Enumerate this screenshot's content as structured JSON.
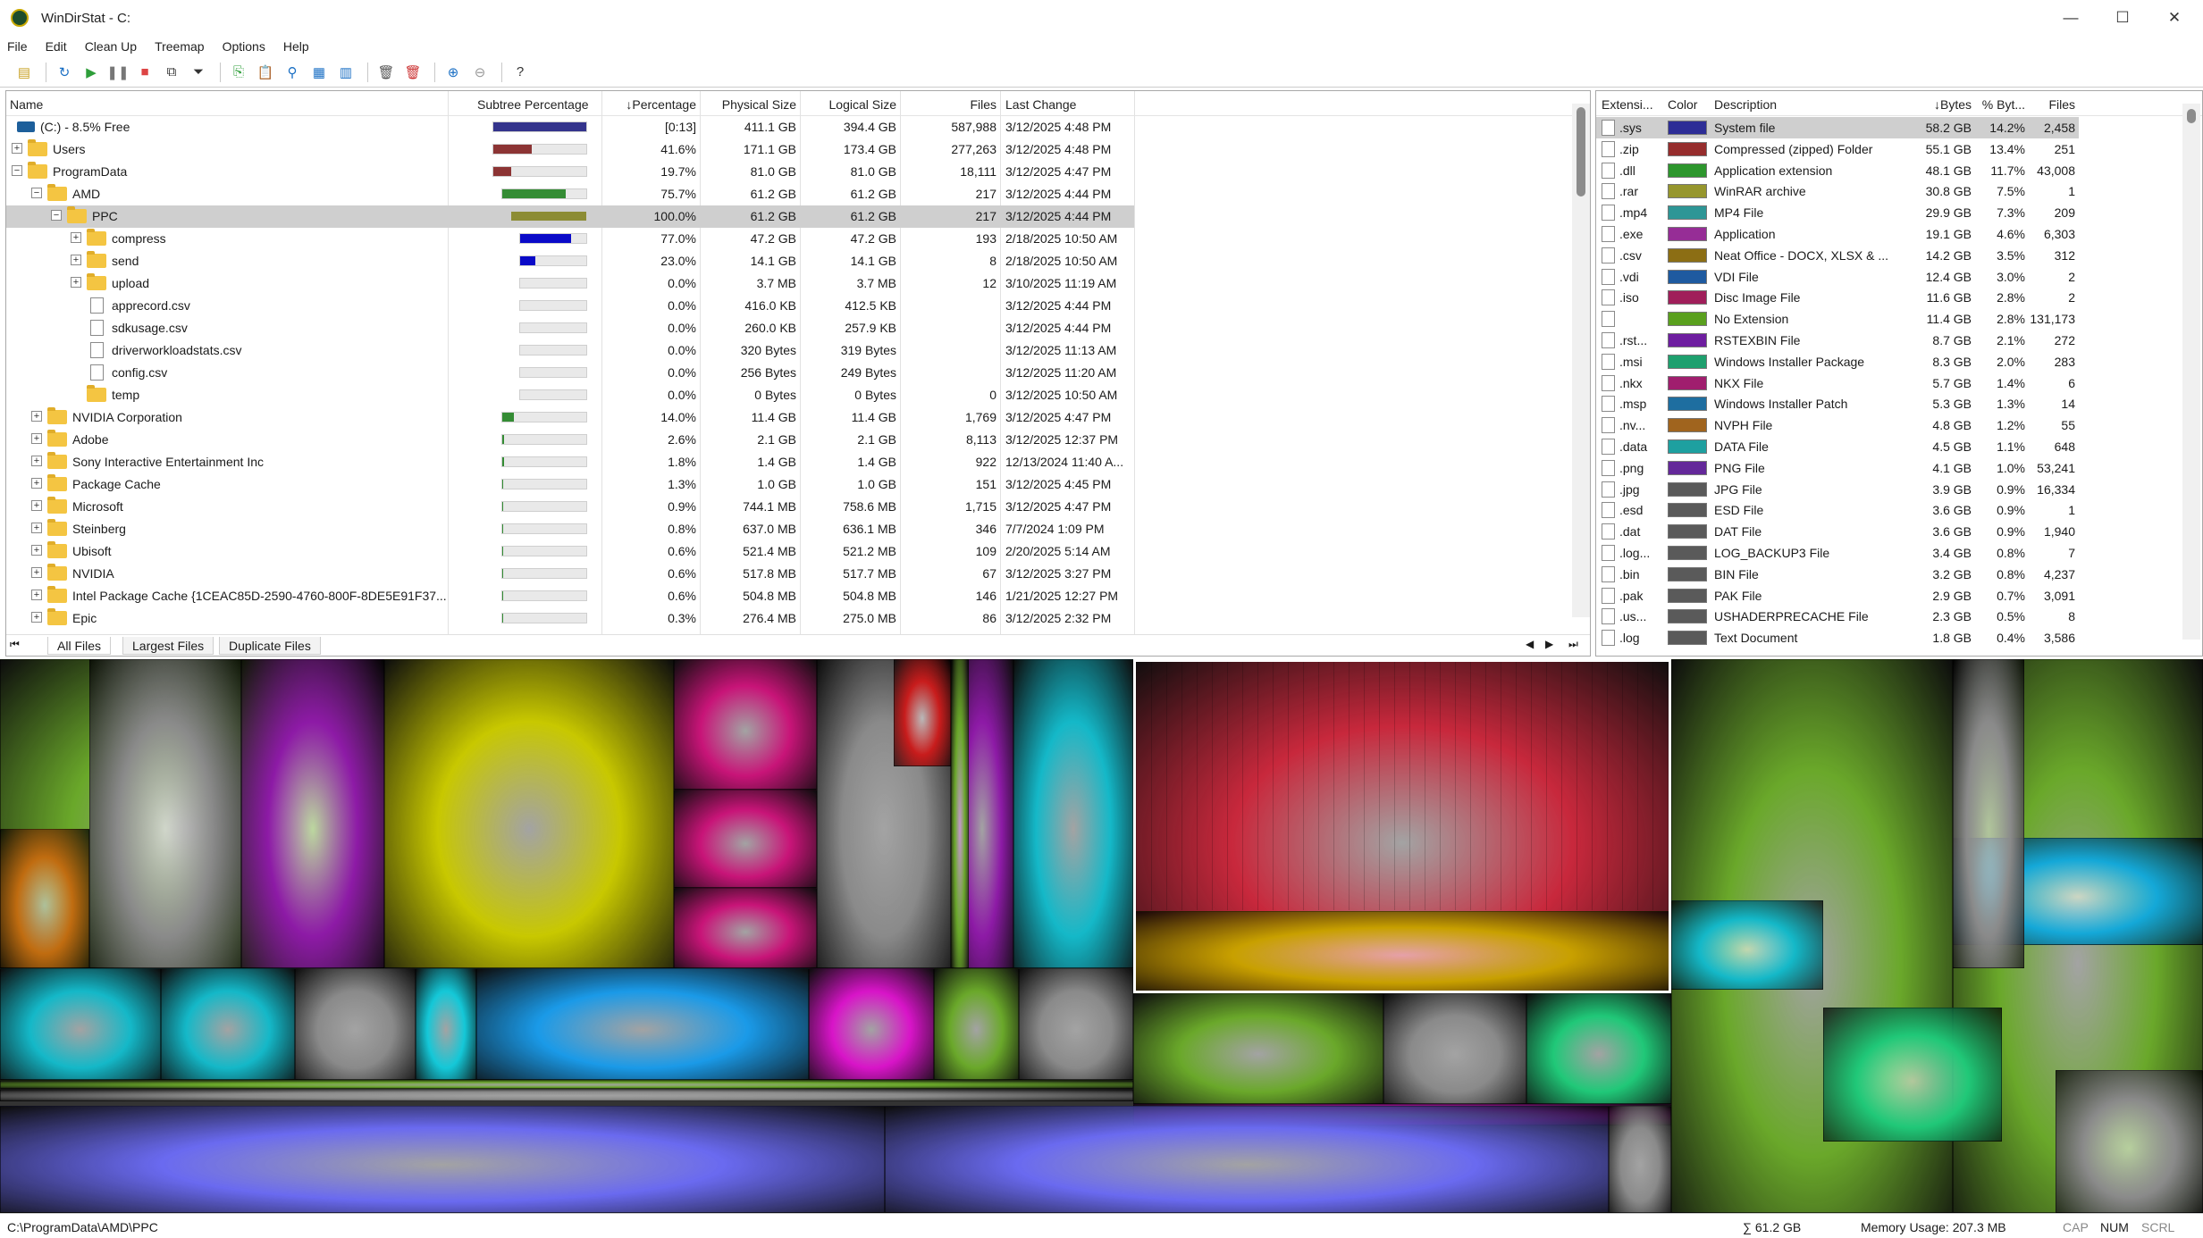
{
  "window": {
    "title": "WinDirStat - C:"
  },
  "menu": [
    "File",
    "Edit",
    "Clean Up",
    "Treemap",
    "Options",
    "Help"
  ],
  "toolbar_icons": [
    "open-icon",
    "refresh-icon",
    "play-icon",
    "pause-icon",
    "stop-icon",
    "copy-path-icon",
    "filter-icon",
    "new-doc-icon",
    "paste-icon",
    "explorer-icon",
    "properties-icon",
    "report-icon",
    "delete-icon",
    "delete-permanent-icon",
    "zoom-in-icon",
    "zoom-out-icon",
    "help-icon"
  ],
  "tree": {
    "headers": {
      "name": "Name",
      "subtree": "Subtree Percentage",
      "percentage": "↓Percentage",
      "physical": "Physical Size",
      "logical": "Logical Size",
      "files": "Files",
      "last_change": "Last Change"
    },
    "rows": [
      {
        "name": "(C:) - 8.5% Free",
        "level": 0,
        "type": "drive",
        "bar": 1.0,
        "barcolor": "#34348c",
        "pct": "[0:13]",
        "phys": "411.1 GB",
        "log": "394.4 GB",
        "files": "587,988",
        "date": "3/12/2025  4:48 PM"
      },
      {
        "name": "Users",
        "level": 0,
        "type": "folder",
        "tog": "+",
        "bar": 0.416,
        "barcolor": "#8c3434",
        "pct": "41.6%",
        "phys": "171.1 GB",
        "log": "173.4 GB",
        "files": "277,263",
        "date": "3/12/2025  4:48 PM"
      },
      {
        "name": "ProgramData",
        "level": 0,
        "type": "folder",
        "tog": "−",
        "bar": 0.197,
        "barcolor": "#8c3434",
        "pct": "19.7%",
        "phys": "81.0 GB",
        "log": "81.0 GB",
        "files": "18,111",
        "date": "3/12/2025  4:47 PM"
      },
      {
        "name": "AMD",
        "level": 1,
        "type": "folder",
        "tog": "−",
        "bar": 0.757,
        "barcolor": "#348c34",
        "pct": "75.7%",
        "phys": "61.2 GB",
        "log": "61.2 GB",
        "files": "217",
        "date": "3/12/2025  4:44 PM"
      },
      {
        "name": "PPC",
        "level": 2,
        "type": "folder",
        "tog": "−",
        "bar": 1.0,
        "barcolor": "#8c8c34",
        "pct": "100.0%",
        "phys": "61.2 GB",
        "log": "61.2 GB",
        "files": "217",
        "date": "3/12/2025  4:44 PM",
        "selected": true
      },
      {
        "name": "compress",
        "level": 3,
        "type": "folder",
        "tog": "+",
        "bar": 0.77,
        "barcolor": "#0a0ac8",
        "pct": "77.0%",
        "phys": "47.2 GB",
        "log": "47.2 GB",
        "files": "193",
        "date": "2/18/2025  10:50 AM"
      },
      {
        "name": "send",
        "level": 3,
        "type": "folder",
        "tog": "+",
        "bar": 0.23,
        "barcolor": "#0a0ac8",
        "pct": "23.0%",
        "phys": "14.1 GB",
        "log": "14.1 GB",
        "files": "8",
        "date": "2/18/2025  10:50 AM"
      },
      {
        "name": "upload",
        "level": 3,
        "type": "folder",
        "tog": "+",
        "bar": 0.0,
        "barcolor": "#0a0ac8",
        "pct": "0.0%",
        "phys": "3.7 MB",
        "log": "3.7 MB",
        "files": "12",
        "date": "3/10/2025  11:19 AM"
      },
      {
        "name": "apprecord.csv",
        "level": 3,
        "type": "file",
        "bar": 0.0,
        "barcolor": "#0a0ac8",
        "pct": "0.0%",
        "phys": "416.0 KB",
        "log": "412.5 KB",
        "files": "",
        "date": "3/12/2025  4:44 PM"
      },
      {
        "name": "sdkusage.csv",
        "level": 3,
        "type": "file",
        "bar": 0.0,
        "barcolor": "#0a0ac8",
        "pct": "0.0%",
        "phys": "260.0 KB",
        "log": "257.9 KB",
        "files": "",
        "date": "3/12/2025  4:44 PM"
      },
      {
        "name": "driverworkloadstats.csv",
        "level": 3,
        "type": "file",
        "bar": 0.0,
        "barcolor": "#0a0ac8",
        "pct": "0.0%",
        "phys": "320 Bytes",
        "log": "319 Bytes",
        "files": "",
        "date": "3/12/2025  11:13 AM"
      },
      {
        "name": "config.csv",
        "level": 3,
        "type": "file",
        "bar": 0.0,
        "barcolor": "#0a0ac8",
        "pct": "0.0%",
        "phys": "256 Bytes",
        "log": "249 Bytes",
        "files": "",
        "date": "3/12/2025  11:20 AM"
      },
      {
        "name": "temp",
        "level": 3,
        "type": "folder",
        "bar": 0.0,
        "barcolor": "#0a0ac8",
        "pct": "0.0%",
        "phys": "0 Bytes",
        "log": "0 Bytes",
        "files": "0",
        "date": "3/12/2025  10:50 AM"
      },
      {
        "name": "NVIDIA Corporation",
        "level": 1,
        "type": "folder",
        "tog": "+",
        "bar": 0.14,
        "barcolor": "#348c34",
        "pct": "14.0%",
        "phys": "11.4 GB",
        "log": "11.4 GB",
        "files": "1,769",
        "date": "3/12/2025  4:47 PM"
      },
      {
        "name": "Adobe",
        "level": 1,
        "type": "folder",
        "tog": "+",
        "bar": 0.026,
        "barcolor": "#348c34",
        "pct": "2.6%",
        "phys": "2.1 GB",
        "log": "2.1 GB",
        "files": "8,113",
        "date": "3/12/2025  12:37 PM"
      },
      {
        "name": "Sony Interactive Entertainment Inc",
        "level": 1,
        "type": "folder",
        "tog": "+",
        "bar": 0.018,
        "barcolor": "#348c34",
        "pct": "1.8%",
        "phys": "1.4 GB",
        "log": "1.4 GB",
        "files": "922",
        "date": "12/13/2024  11:40 A..."
      },
      {
        "name": "Package Cache",
        "level": 1,
        "type": "folder",
        "tog": "+",
        "bar": 0.013,
        "barcolor": "#348c34",
        "pct": "1.3%",
        "phys": "1.0 GB",
        "log": "1.0 GB",
        "files": "151",
        "date": "3/12/2025  4:45 PM"
      },
      {
        "name": "Microsoft",
        "level": 1,
        "type": "folder",
        "tog": "+",
        "bar": 0.009,
        "barcolor": "#348c34",
        "pct": "0.9%",
        "phys": "744.1 MB",
        "log": "758.6 MB",
        "files": "1,715",
        "date": "3/12/2025  4:47 PM"
      },
      {
        "name": "Steinberg",
        "level": 1,
        "type": "folder",
        "tog": "+",
        "bar": 0.008,
        "barcolor": "#348c34",
        "pct": "0.8%",
        "phys": "637.0 MB",
        "log": "636.1 MB",
        "files": "346",
        "date": "7/7/2024  1:09 PM"
      },
      {
        "name": "Ubisoft",
        "level": 1,
        "type": "folder",
        "tog": "+",
        "bar": 0.006,
        "barcolor": "#348c34",
        "pct": "0.6%",
        "phys": "521.4 MB",
        "log": "521.2 MB",
        "files": "109",
        "date": "2/20/2025  5:14 AM"
      },
      {
        "name": "NVIDIA",
        "level": 1,
        "type": "folder",
        "tog": "+",
        "bar": 0.006,
        "barcolor": "#348c34",
        "pct": "0.6%",
        "phys": "517.8 MB",
        "log": "517.7 MB",
        "files": "67",
        "date": "3/12/2025  3:27 PM"
      },
      {
        "name": "Intel Package Cache {1CEAC85D-2590-4760-800F-8DE5E91F37...",
        "level": 1,
        "type": "folder",
        "tog": "+",
        "bar": 0.006,
        "barcolor": "#348c34",
        "pct": "0.6%",
        "phys": "504.8 MB",
        "log": "504.8 MB",
        "files": "146",
        "date": "1/21/2025  12:27 PM"
      },
      {
        "name": "Epic",
        "level": 1,
        "type": "folder",
        "tog": "+",
        "bar": 0.003,
        "barcolor": "#348c34",
        "pct": "0.3%",
        "phys": "276.4 MB",
        "log": "275.0 MB",
        "files": "86",
        "date": "3/12/2025  2:32 PM"
      }
    ],
    "tabs": [
      "All Files",
      "Largest Files",
      "Duplicate Files"
    ]
  },
  "ext": {
    "headers": {
      "ext": "Extensi...",
      "color": "Color",
      "desc": "Description",
      "bytes": "↓Bytes",
      "pct": "% Byt...",
      "files": "Files"
    },
    "rows": [
      {
        "ext": ".sys",
        "color": "#2d2d96",
        "desc": "System file",
        "bytes": "58.2 GB",
        "pct": "14.2%",
        "files": "2,458",
        "selected": true
      },
      {
        "ext": ".zip",
        "color": "#962d2d",
        "desc": "Compressed (zipped) Folder",
        "bytes": "55.1 GB",
        "pct": "13.4%",
        "files": "251"
      },
      {
        "ext": ".dll",
        "color": "#2d962d",
        "desc": "Application extension",
        "bytes": "48.1 GB",
        "pct": "11.7%",
        "files": "43,008"
      },
      {
        "ext": ".rar",
        "color": "#96962d",
        "desc": "WinRAR archive",
        "bytes": "30.8 GB",
        "pct": "7.5%",
        "files": "1"
      },
      {
        "ext": ".mp4",
        "color": "#2d9696",
        "desc": "MP4 File",
        "bytes": "29.9 GB",
        "pct": "7.3%",
        "files": "209"
      },
      {
        "ext": ".exe",
        "color": "#962d96",
        "desc": "Application",
        "bytes": "19.1 GB",
        "pct": "4.6%",
        "files": "6,303"
      },
      {
        "ext": ".csv",
        "color": "#8c6e14",
        "desc": "Neat Office - DOCX, XLSX & ...",
        "bytes": "14.2 GB",
        "pct": "3.5%",
        "files": "312"
      },
      {
        "ext": ".vdi",
        "color": "#1e5aa0",
        "desc": "VDI File",
        "bytes": "12.4 GB",
        "pct": "3.0%",
        "files": "2"
      },
      {
        "ext": ".iso",
        "color": "#a01e5a",
        "desc": "Disc Image File",
        "bytes": "11.6 GB",
        "pct": "2.8%",
        "files": "2"
      },
      {
        "ext": "",
        "color": "#5aa01e",
        "desc": "No Extension",
        "bytes": "11.4 GB",
        "pct": "2.8%",
        "files": "131,173"
      },
      {
        "ext": ".rst...",
        "color": "#6e1ea0",
        "desc": "RSTEXBIN File",
        "bytes": "8.7 GB",
        "pct": "2.1%",
        "files": "272"
      },
      {
        "ext": ".msi",
        "color": "#1ea06e",
        "desc": "Windows Installer Package",
        "bytes": "8.3 GB",
        "pct": "2.0%",
        "files": "283"
      },
      {
        "ext": ".nkx",
        "color": "#a01e6e",
        "desc": "NKX File",
        "bytes": "5.7 GB",
        "pct": "1.4%",
        "files": "6"
      },
      {
        "ext": ".msp",
        "color": "#1e6ea0",
        "desc": "Windows Installer Patch",
        "bytes": "5.3 GB",
        "pct": "1.3%",
        "files": "14"
      },
      {
        "ext": ".nv...",
        "color": "#a0641e",
        "desc": "NVPH File",
        "bytes": "4.8 GB",
        "pct": "1.2%",
        "files": "55"
      },
      {
        "ext": ".data",
        "color": "#1ea0a0",
        "desc": "DATA File",
        "bytes": "4.5 GB",
        "pct": "1.1%",
        "files": "648"
      },
      {
        "ext": ".png",
        "color": "#64289a",
        "desc": "PNG File",
        "bytes": "4.1 GB",
        "pct": "1.0%",
        "files": "53,241"
      },
      {
        "ext": ".jpg",
        "color": "#5a5a5a",
        "desc": "JPG File",
        "bytes": "3.9 GB",
        "pct": "0.9%",
        "files": "16,334"
      },
      {
        "ext": ".esd",
        "color": "#5a5a5a",
        "desc": "ESD File",
        "bytes": "3.6 GB",
        "pct": "0.9%",
        "files": "1"
      },
      {
        "ext": ".dat",
        "color": "#5a5a5a",
        "desc": "DAT File",
        "bytes": "3.6 GB",
        "pct": "0.9%",
        "files": "1,940"
      },
      {
        "ext": ".log...",
        "color": "#5a5a5a",
        "desc": "LOG_BACKUP3 File",
        "bytes": "3.4 GB",
        "pct": "0.8%",
        "files": "7"
      },
      {
        "ext": ".bin",
        "color": "#5a5a5a",
        "desc": "BIN File",
        "bytes": "3.2 GB",
        "pct": "0.8%",
        "files": "4,237"
      },
      {
        "ext": ".pak",
        "color": "#5a5a5a",
        "desc": "PAK File",
        "bytes": "2.9 GB",
        "pct": "0.7%",
        "files": "3,091"
      },
      {
        "ext": ".us...",
        "color": "#5a5a5a",
        "desc": "USHADERPRECACHE File",
        "bytes": "2.3 GB",
        "pct": "0.5%",
        "files": "8"
      },
      {
        "ext": ".log",
        "color": "#5a5a5a",
        "desc": "Text Document",
        "bytes": "1.8 GB",
        "pct": "0.4%",
        "files": "3,586"
      }
    ]
  },
  "status": {
    "path": "C:\\ProgramData\\AMD\\PPC",
    "sum": "∑ 61.2 GB",
    "memory": "Memory Usage: 207.3 MB",
    "cap": "CAP",
    "num": "NUM",
    "scrl": "SCRL"
  }
}
